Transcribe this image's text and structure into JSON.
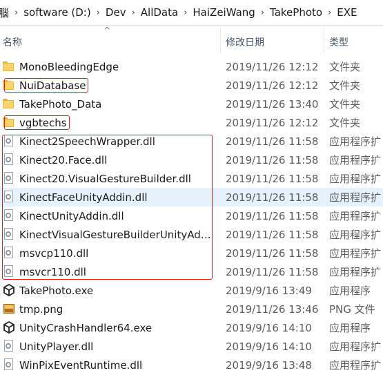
{
  "breadcrumb": {
    "items": [
      "腦",
      "software (D:)",
      "Dev",
      "AllData",
      "HaiZeiWang",
      "TakePhoto",
      "EXE"
    ],
    "separator": "›"
  },
  "columns": {
    "name": "名称",
    "date": "修改日期",
    "type": "类型",
    "sort_indicator": "^"
  },
  "files": [
    {
      "name": "MonoBleedingEdge",
      "date": "2019/11/26 12:12",
      "type": "文件夹",
      "icon": "folder-icon"
    },
    {
      "name": "NuiDatabase",
      "date": "2019/11/26 12:12",
      "type": "文件夹",
      "icon": "folder-icon"
    },
    {
      "name": "TakePhoto_Data",
      "date": "2019/11/26 13:40",
      "type": "文件夹",
      "icon": "folder-icon"
    },
    {
      "name": "vgbtechs",
      "date": "2019/11/26 12:12",
      "type": "文件夹",
      "icon": "folder-icon"
    },
    {
      "name": "Kinect2SpeechWrapper.dll",
      "date": "2019/11/26 11:58",
      "type": "应用程序扩",
      "icon": "dll-icon"
    },
    {
      "name": "Kinect20.Face.dll",
      "date": "2019/11/26 11:58",
      "type": "应用程序扩",
      "icon": "dll-icon"
    },
    {
      "name": "Kinect20.VisualGestureBuilder.dll",
      "date": "2019/11/26 11:58",
      "type": "应用程序扩",
      "icon": "dll-icon"
    },
    {
      "name": "KinectFaceUnityAddin.dll",
      "date": "2019/11/26 11:58",
      "type": "应用程序扩",
      "icon": "dll-icon"
    },
    {
      "name": "KinectUnityAddin.dll",
      "date": "2019/11/26 11:58",
      "type": "应用程序扩",
      "icon": "dll-icon"
    },
    {
      "name": "KinectVisualGestureBuilderUnityAddi...",
      "date": "2019/11/26 11:58",
      "type": "应用程序扩",
      "icon": "dll-icon"
    },
    {
      "name": "msvcp110.dll",
      "date": "2019/11/26 11:58",
      "type": "应用程序扩",
      "icon": "dll-icon"
    },
    {
      "name": "msvcr110.dll",
      "date": "2019/11/26 11:58",
      "type": "应用程序扩",
      "icon": "dll-icon"
    },
    {
      "name": "TakePhoto.exe",
      "date": "2019/9/16 13:49",
      "type": "应用程序",
      "icon": "unity-icon"
    },
    {
      "name": "tmp.png",
      "date": "2019/11/26 13:46",
      "type": "PNG 文件",
      "icon": "png-icon"
    },
    {
      "name": "UnityCrashHandler64.exe",
      "date": "2019/9/16 14:10",
      "type": "应用程序",
      "icon": "unity-icon"
    },
    {
      "name": "UnityPlayer.dll",
      "date": "2019/9/16 14:10",
      "type": "应用程序扩",
      "icon": "dll-icon"
    },
    {
      "name": "WinPixEventRuntime.dll",
      "date": "2019/9/16 13:48",
      "type": "应用程序扩",
      "icon": "dll-icon"
    }
  ],
  "highlighted_row": 7,
  "colors": {
    "highlight": "#e5f1fb",
    "annotation": "#e02020",
    "folder": "#f8d36e"
  }
}
